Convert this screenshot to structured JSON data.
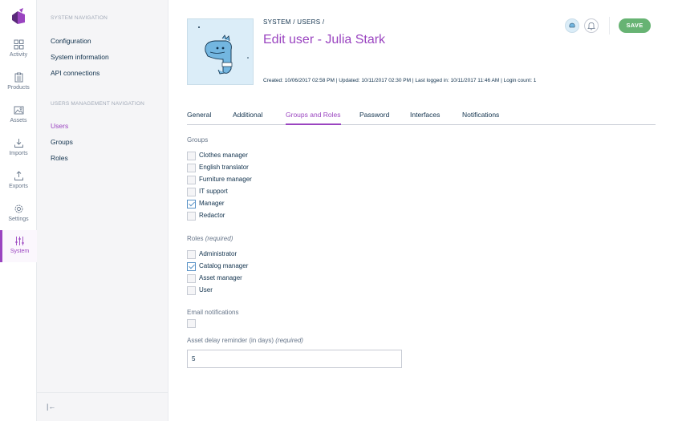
{
  "main_nav": {
    "items": [
      {
        "label": "Activity",
        "icon": "dashboard-icon"
      },
      {
        "label": "Products",
        "icon": "clipboard-icon"
      },
      {
        "label": "Assets",
        "icon": "image-icon"
      },
      {
        "label": "Imports",
        "icon": "import-icon"
      },
      {
        "label": "Exports",
        "icon": "export-icon"
      },
      {
        "label": "Settings",
        "icon": "gear-icon"
      },
      {
        "label": "System",
        "icon": "sliders-icon"
      }
    ],
    "active": "System"
  },
  "sub_nav": {
    "system_title": "SYSTEM NAVIGATION",
    "system_links": [
      "Configuration",
      "System information",
      "API connections"
    ],
    "users_title": "USERS MANAGEMENT NAVIGATION",
    "users_links": [
      "Users",
      "Groups",
      "Roles"
    ],
    "active": "Users"
  },
  "header": {
    "breadcrumb": "SYSTEM / USERS /",
    "title": "Edit user - Julia Stark",
    "meta": "Created: 10/06/2017 02:58 PM | Updated: 10/11/2017 02:30 PM | Last logged in: 10/11/2017 11:46 AM | Login count: 1",
    "save_label": "SAVE"
  },
  "tabs": [
    "General",
    "Additional",
    "Groups and Roles",
    "Password",
    "Interfaces",
    "Notifications"
  ],
  "active_tab": "Groups and Roles",
  "groups": {
    "label": "Groups",
    "items": [
      {
        "label": "Clothes manager",
        "checked": false
      },
      {
        "label": "English translator",
        "checked": false
      },
      {
        "label": "Furniture manager",
        "checked": false
      },
      {
        "label": "IT support",
        "checked": false
      },
      {
        "label": "Manager",
        "checked": true
      },
      {
        "label": "Redactor",
        "checked": false
      }
    ]
  },
  "roles": {
    "label": "Roles",
    "required": "(required)",
    "items": [
      {
        "label": "Administrator",
        "checked": false
      },
      {
        "label": "Catalog manager",
        "checked": true
      },
      {
        "label": "Asset manager",
        "checked": false
      },
      {
        "label": "User",
        "checked": false
      }
    ]
  },
  "email_notifications": {
    "label": "Email notifications",
    "checked": false
  },
  "asset_delay": {
    "label": "Asset delay reminder (in days)",
    "required": "(required)",
    "value": "5"
  },
  "colors": {
    "accent": "#9a44c0",
    "save": "#67b373",
    "checkbox": "#5992c6"
  }
}
